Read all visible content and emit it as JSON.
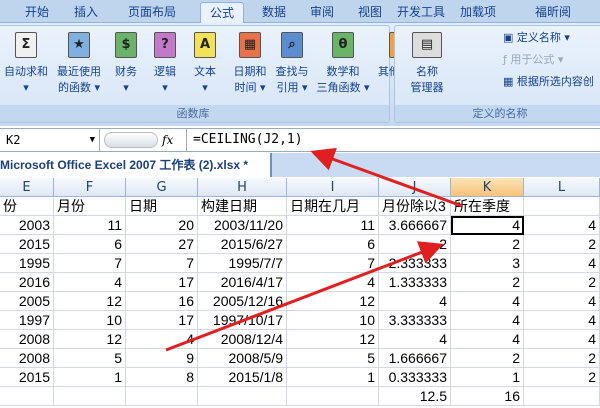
{
  "tabs": [
    "开始",
    "插入",
    "页面布局",
    "公式",
    "数据",
    "审阅",
    "视图",
    "开发工具",
    "加载项",
    "福昕阅"
  ],
  "active_tab": "公式",
  "ribbon": {
    "function_library": {
      "label": "函数库",
      "buttons": [
        {
          "l1": "自动求和",
          "l2": "▾",
          "icon": "Σ",
          "color": "#f0f0f0"
        },
        {
          "l1": "最近使用",
          "l2": "的函数 ▾",
          "icon": "★",
          "color": "#7fb0e0"
        },
        {
          "l1": "财务",
          "l2": "▾",
          "icon": "$",
          "color": "#6ab46a"
        },
        {
          "l1": "逻辑",
          "l2": "▾",
          "icon": "?",
          "color": "#c27ac8"
        },
        {
          "l1": "文本",
          "l2": "▾",
          "icon": "A",
          "color": "#f2e25a"
        },
        {
          "l1": "日期和",
          "l2": "时间 ▾",
          "icon": "▦",
          "color": "#e8734a"
        },
        {
          "l1": "查找与",
          "l2": "引用 ▾",
          "icon": "⌕",
          "color": "#5a8ed0"
        },
        {
          "l1": "数学和",
          "l2": "三角函数 ▾",
          "icon": "θ",
          "color": "#6ab46a"
        },
        {
          "l1": "其他函数",
          "l2": "▾",
          "icon": "▥",
          "color": "#f3a040"
        }
      ]
    },
    "defined_names": {
      "label": "定义的名称",
      "name_manager_l1": "名称",
      "name_manager_l2": "管理器",
      "define_name": "定义名称 ▾",
      "use_in_formula": "用于公式 ▾",
      "create_from_selection": "根据所选内容创"
    }
  },
  "formula_bar": {
    "name_box": "K2",
    "fx": "fx",
    "formula": "=CEILING(J2,1)"
  },
  "document_tab": "Microsoft Office Excel 2007 工作表 (2).xlsx *",
  "columns": [
    "E",
    "F",
    "G",
    "H",
    "I",
    "J",
    "K",
    "L"
  ],
  "selected_column": "K",
  "header_row": [
    "份",
    "月份",
    "日期",
    "构建日期",
    "日期在几月",
    "月份除以3",
    "所在季度",
    ""
  ],
  "rows": [
    [
      "2003",
      "11",
      "20",
      "2003/11/20",
      "11",
      "3.666667",
      "4",
      "4"
    ],
    [
      "2015",
      "6",
      "27",
      "2015/6/27",
      "6",
      "2",
      "2",
      "2"
    ],
    [
      "1995",
      "7",
      "7",
      "1995/7/7",
      "7",
      "2.333333",
      "3",
      "4"
    ],
    [
      "2016",
      "4",
      "17",
      "2016/4/17",
      "4",
      "1.333333",
      "2",
      "2"
    ],
    [
      "2005",
      "12",
      "16",
      "2005/12/16",
      "12",
      "4",
      "4",
      "4"
    ],
    [
      "1997",
      "10",
      "17",
      "1997/10/17",
      "10",
      "3.333333",
      "4",
      "4"
    ],
    [
      "2008",
      "12",
      "4",
      "2008/12/4",
      "12",
      "4",
      "4",
      "4"
    ],
    [
      "2008",
      "5",
      "9",
      "2008/5/9",
      "5",
      "1.666667",
      "2",
      "2"
    ],
    [
      "2015",
      "1",
      "8",
      "2015/1/8",
      "1",
      "0.333333",
      "1",
      "2"
    ],
    [
      "",
      "",
      "",
      "",
      "",
      "12.5",
      "16",
      ""
    ]
  ],
  "colors": {
    "arrow": "#e02020",
    "selection": "#000000"
  }
}
